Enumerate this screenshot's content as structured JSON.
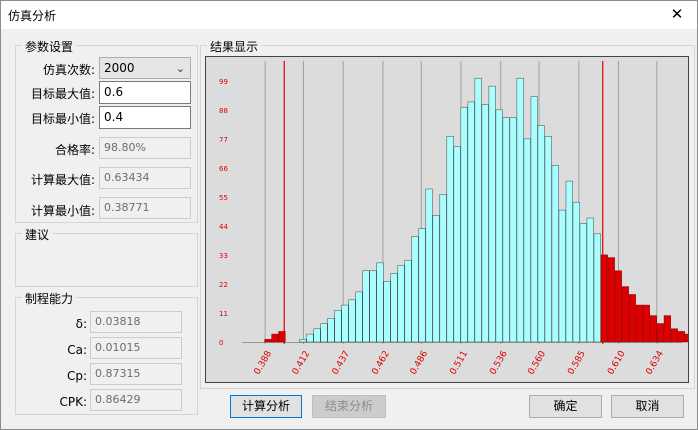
{
  "window": {
    "title": "仿真分析",
    "close_glyph": "✕"
  },
  "params": {
    "title": "参数设置",
    "sim_count_label": "仿真次数:",
    "sim_count_value": "2000",
    "target_max_label": "目标最大值:",
    "target_max_value": "0.6",
    "target_min_label": "目标最小值:",
    "target_min_value": "0.4",
    "pass_rate_label": "合格率:",
    "pass_rate_value": "98.80%",
    "calc_max_label": "计算最大值:",
    "calc_max_value": "0.63434",
    "calc_min_label": "计算最小值:",
    "calc_min_value": "0.38771"
  },
  "advice": {
    "title": "建议"
  },
  "capability": {
    "title": "制程能力",
    "sigma_label": "δ:",
    "sigma_value": "0.03818",
    "ca_label": "Ca:",
    "ca_value": "0.01015",
    "cp_label": "Cp:",
    "cp_value": "0.87315",
    "cpk_label": "CPK:",
    "cpk_value": "0.86429"
  },
  "results": {
    "title": "结果显示"
  },
  "buttons": {
    "calc": "计算分析",
    "stop": "结束分析",
    "ok": "确定",
    "cancel": "取消"
  },
  "icons": {
    "dropdown": "chevron-down-icon",
    "close": "close-icon"
  },
  "colors": {
    "in_spec_bar": "#a8ffff",
    "out_spec_bar": "#dd0000",
    "limit_line": "#dd0000",
    "axis_labels": "#dd0000",
    "plot_bg": "#dcdcdc"
  },
  "chart_data": {
    "type": "bar",
    "title": "",
    "xlabel": "",
    "ylabel": "",
    "x_tick_labels": [
      "0.388",
      "0.412",
      "0.437",
      "0.462",
      "0.486",
      "0.511",
      "0.536",
      "0.560",
      "0.585",
      "0.610",
      "0.634"
    ],
    "y_tick_labels": [
      "0",
      "11",
      "22",
      "33",
      "44",
      "55",
      "66",
      "77",
      "88",
      "99"
    ],
    "ylim": [
      0,
      105
    ],
    "xlim": [
      0.376,
      0.646
    ],
    "lower_limit": 0.4,
    "upper_limit": 0.6,
    "bin_width": 0.0044,
    "bin_start": 0.3877,
    "counts": [
      1,
      3,
      4,
      0,
      0,
      1,
      3,
      5,
      7,
      9,
      12,
      14,
      16,
      19,
      27,
      27,
      30,
      23,
      26,
      29,
      31,
      40,
      43,
      58,
      48,
      56,
      78,
      74,
      89,
      91,
      100,
      90,
      97,
      88,
      85,
      85,
      100,
      77,
      93,
      82,
      78,
      67,
      50,
      61,
      53,
      45,
      47,
      41,
      33,
      32,
      27,
      21,
      18,
      14,
      14,
      10,
      7,
      10,
      5,
      4,
      3,
      2,
      4,
      1,
      0,
      1,
      1,
      0,
      3,
      0,
      0,
      0,
      0,
      1
    ]
  }
}
